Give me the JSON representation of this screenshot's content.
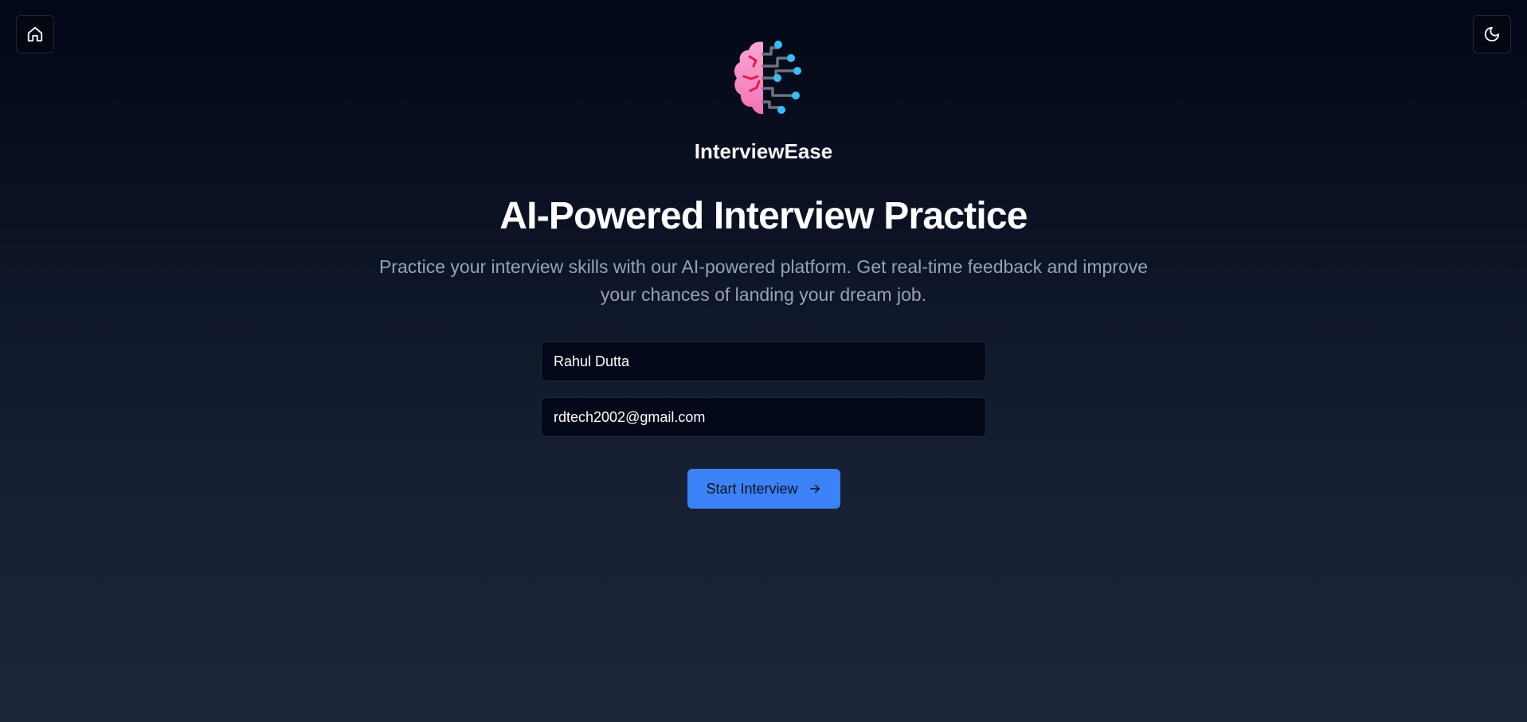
{
  "header": {
    "home_icon": "home-icon",
    "theme_icon": "moon-icon"
  },
  "brand": {
    "logo_icon": "brain-circuit-icon",
    "name": "InterviewEase"
  },
  "hero": {
    "title": "AI-Powered Interview Practice",
    "subtitle": "Practice your interview skills with our AI-powered platform. Get real-time feedback and improve your chances of landing your dream job."
  },
  "form": {
    "name_value": "Rahul Dutta",
    "email_value": "rdtech2002@gmail.com",
    "submit_label": "Start Interview",
    "submit_icon": "arrow-right-icon"
  },
  "colors": {
    "accent": "#3b82f6",
    "background_top": "#030816",
    "background_bottom": "#1c253a",
    "brain_pink": "#f472b6",
    "circuit_node": "#38bdf8"
  }
}
